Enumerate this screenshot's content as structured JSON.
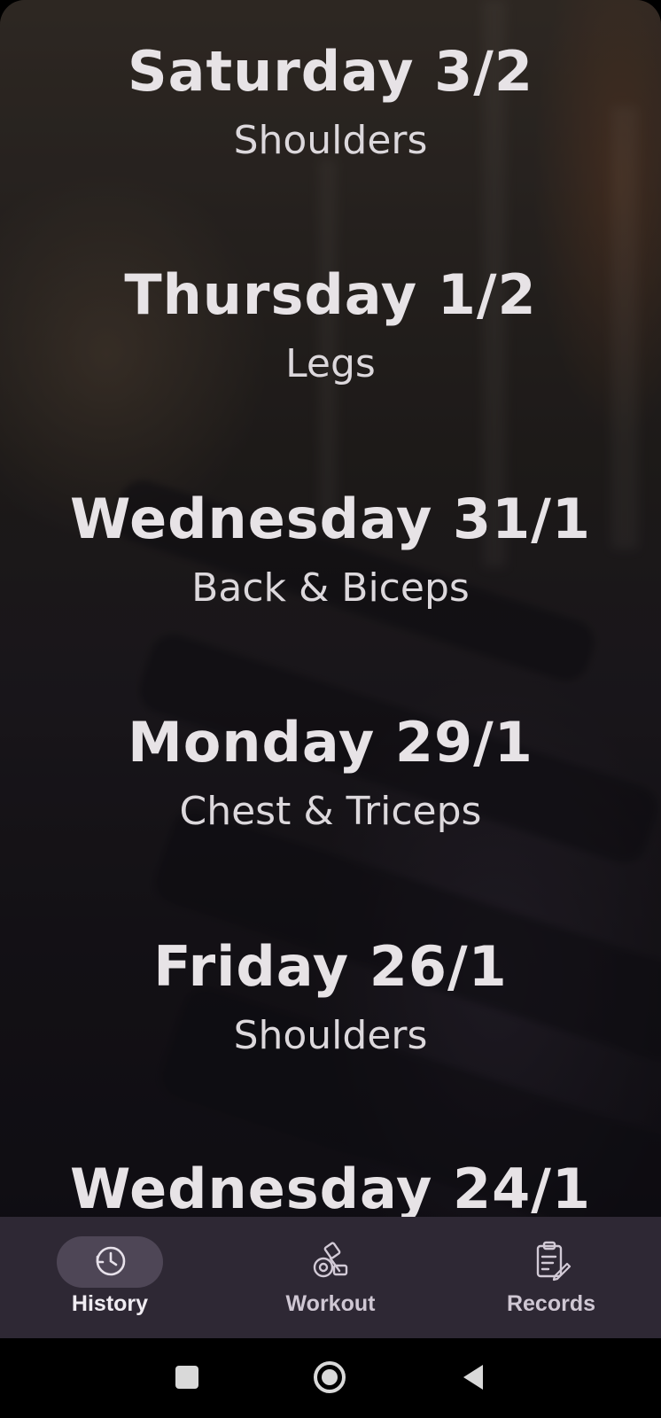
{
  "history": [
    {
      "day": "Saturday 3/2",
      "group": "Shoulders"
    },
    {
      "day": "Thursday 1/2",
      "group": "Legs"
    },
    {
      "day": "Wednesday 31/1",
      "group": "Back & Biceps"
    },
    {
      "day": "Monday 29/1",
      "group": "Chest & Triceps"
    },
    {
      "day": "Friday 26/1",
      "group": "Shoulders"
    },
    {
      "day": "Wednesday 24/1",
      "group": ""
    }
  ],
  "nav": {
    "items": [
      {
        "label": "History",
        "icon": "history-icon",
        "active": true
      },
      {
        "label": "Workout",
        "icon": "dumbbell-icon",
        "active": false
      },
      {
        "label": "Records",
        "icon": "clipboard-icon",
        "active": false
      }
    ]
  },
  "system_nav": {
    "buttons": [
      "recents-icon",
      "home-icon",
      "back-icon"
    ]
  },
  "colors": {
    "nav_background": "#2e2834",
    "active_pill": "#4e4656",
    "text": "#e7e3e6"
  }
}
